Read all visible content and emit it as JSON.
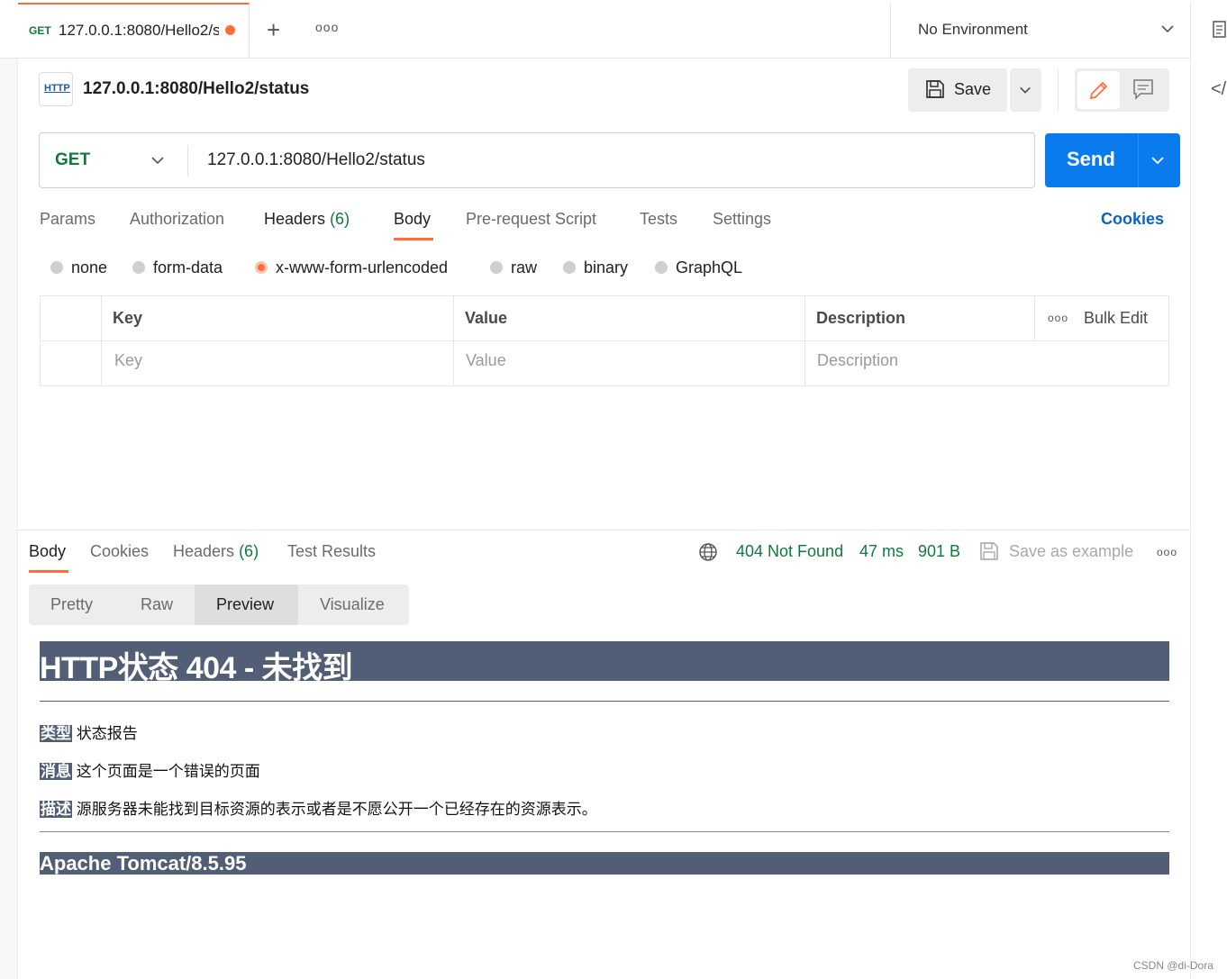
{
  "tab": {
    "method": "GET",
    "title": "127.0.0.1:8080/Hello2/s",
    "more_label": "ooo"
  },
  "environment": {
    "label": "No Environment"
  },
  "request": {
    "title": "127.0.0.1:8080/Hello2/status",
    "http_badge": "HTTP",
    "save_label": "Save",
    "method": "GET",
    "url": "127.0.0.1:8080/Hello2/status",
    "send_label": "Send"
  },
  "request_tabs": {
    "params": "Params",
    "authorization": "Authorization",
    "headers": "Headers",
    "headers_count": "(6)",
    "body": "Body",
    "prerequest": "Pre-request Script",
    "tests": "Tests",
    "settings": "Settings",
    "cookies": "Cookies"
  },
  "body_types": {
    "none": "none",
    "form_data": "form-data",
    "urlencoded": "x-www-form-urlencoded",
    "raw": "raw",
    "binary": "binary",
    "graphql": "GraphQL",
    "selected": "x-www-form-urlencoded"
  },
  "kv_table": {
    "headers": {
      "key": "Key",
      "value": "Value",
      "description": "Description"
    },
    "placeholders": {
      "key": "Key",
      "value": "Value",
      "description": "Description"
    },
    "more_label": "ooo",
    "bulk_edit": "Bulk Edit"
  },
  "response": {
    "tabs": {
      "body": "Body",
      "cookies": "Cookies",
      "headers": "Headers",
      "headers_count": "(6)",
      "test_results": "Test Results"
    },
    "status": "404 Not Found",
    "time": "47 ms",
    "size": "901 B",
    "save_example": "Save as example",
    "more_label": "ooo",
    "views": {
      "pretty": "Pretty",
      "raw": "Raw",
      "preview": "Preview",
      "visualize": "Visualize",
      "selected": "Preview"
    }
  },
  "preview": {
    "heading": "HTTP状态 404 - 未找到",
    "rows": [
      {
        "label": "类型",
        "text": "状态报告"
      },
      {
        "label": "消息",
        "text": "这个页面是一个错误的页面"
      },
      {
        "label": "描述",
        "text": "源服务器未能找到目标资源的表示或者是不愿公开一个已经存在的资源表示。"
      }
    ],
    "footer": "Apache Tomcat/8.5.95"
  },
  "watermark": "CSDN @di-Dora",
  "colors": {
    "accent": "#ff6c37",
    "method_get": "#0f7a3e",
    "send_button": "#097bed",
    "status_ok_text": "#0f7a3e",
    "tomcat_header": "#525d76",
    "link": "#0b63c8"
  }
}
